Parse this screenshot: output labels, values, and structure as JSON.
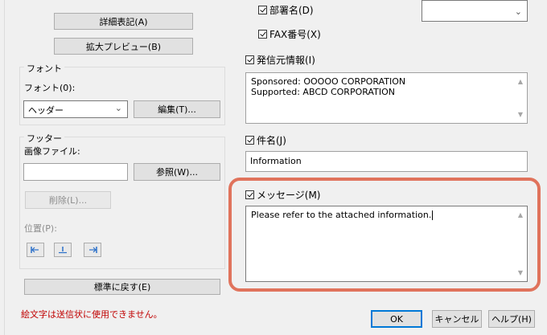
{
  "left": {
    "detail_button": "詳細表記(A)",
    "preview_button": "拡大プレビュー(B)",
    "font_group": {
      "legend": "フォント",
      "font_label": "フォント(0):",
      "font_select": "ヘッダー",
      "edit_button": "編集(T)..."
    },
    "footer_group": {
      "legend": "フッター",
      "image_label": "画像ファイル:",
      "image_value": "",
      "browse_button": "参照(W)...",
      "delete_button": "削除(L)...",
      "position_label": "位置(P):"
    },
    "reset_button": "標準に戻す(E)",
    "warning": "絵文字は送信状に使用できません。"
  },
  "right": {
    "dept_checkbox": "部署名(D)",
    "fax_checkbox": "FAX番号(X)",
    "sender_checkbox": "発信元情報(I)",
    "sender_lines": [
      "Sponsored: OOOOO CORPORATION",
      "Supported: ABCD CORPORATION"
    ],
    "subject_checkbox": "件名(J)",
    "subject_value": "Information",
    "message_checkbox": "メッセージ(M)",
    "message_value": "Please refer to the attached information."
  },
  "footer": {
    "ok": "OK",
    "cancel": "キャンセル",
    "help": "ヘルプ(H)"
  },
  "colors": {
    "highlight": "#e0735c",
    "warning_text": "#c00000",
    "primary_border": "#0078d7"
  },
  "icons": [
    "align-left-icon",
    "align-center-icon",
    "align-right-icon",
    "chevron-down-icon",
    "scroll-up-icon",
    "scroll-down-icon"
  ]
}
